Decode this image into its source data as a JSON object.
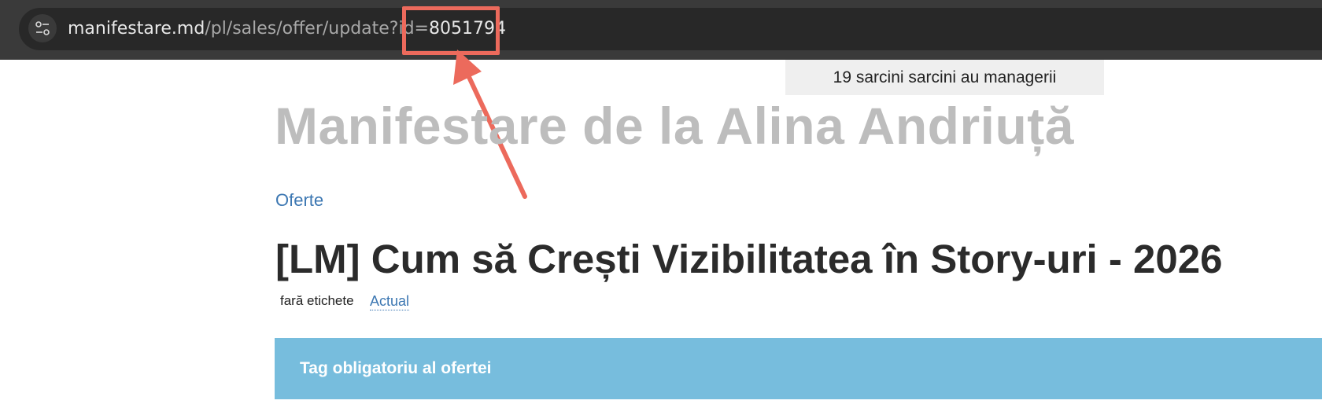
{
  "browser": {
    "url_host": "manifestare.md",
    "url_path": "/pl/sales/offer/update?id=",
    "url_id": "8051794",
    "site_icon": "page-info-tune-icon"
  },
  "annotation": {
    "color": "#ec6a5c"
  },
  "page": {
    "tasks_banner": "19 sarcini sarcini au managerii",
    "site_title": "Manifestare de la Alina Andriuță",
    "breadcrumb": "Oferte",
    "offer_title": "[LM] Cum să Crești Vizibilitatea în Story-uri - 2026",
    "tags_label": "fară etichete",
    "status_link": "Actual",
    "panel_title": "Tag obligatoriu al ofertei"
  },
  "colors": {
    "link": "#3c77b2",
    "panel": "#77bddd",
    "title_gray": "#bdbdbd"
  }
}
